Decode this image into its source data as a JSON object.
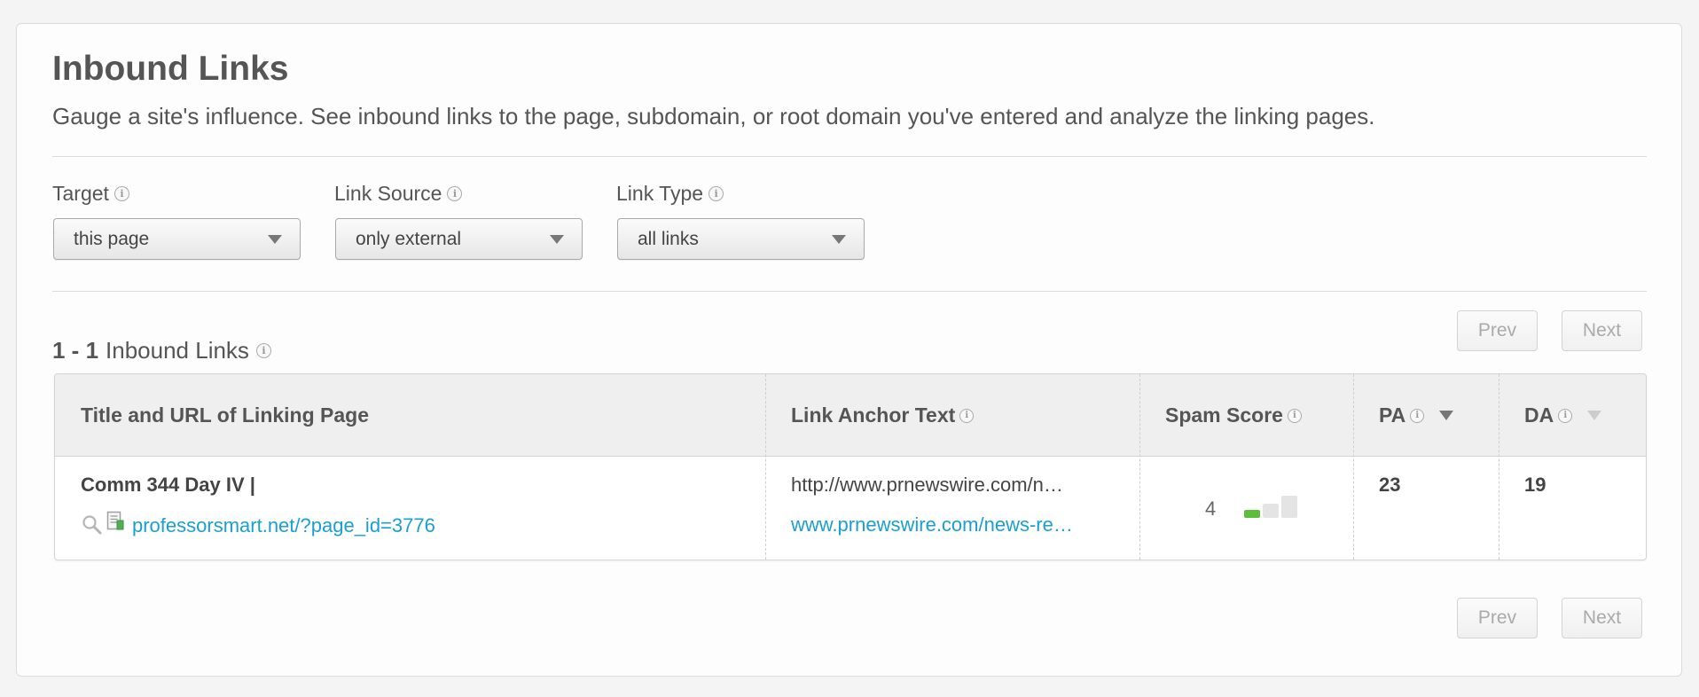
{
  "header": {
    "title": "Inbound Links",
    "subtitle": "Gauge a site's influence. See inbound links to the page, subdomain, or root domain you've entered and analyze the linking pages."
  },
  "filters": {
    "target": {
      "label": "Target",
      "value": "this page"
    },
    "link_source": {
      "label": "Link Source",
      "value": "only external"
    },
    "link_type": {
      "label": "Link Type",
      "value": "all links"
    }
  },
  "results": {
    "range": "1 - 1",
    "label": "Inbound Links"
  },
  "pager": {
    "prev_label": "Prev",
    "next_label": "Next"
  },
  "table": {
    "columns": {
      "title_url": "Title and URL of Linking Page",
      "anchor": "Link Anchor Text",
      "spam": "Spam Score",
      "pa": "PA",
      "da": "DA"
    },
    "rows": [
      {
        "title": "Comm 344 Day IV |",
        "url": "professorsmart.net/?page_id=3776",
        "anchor_text": "http://www.prnewswire.com/n…",
        "target_url": "www.prnewswire.com/news-re…",
        "spam_score": "4",
        "pa": "23",
        "da": "19"
      }
    ]
  },
  "colors": {
    "accent_link": "#1a9fd4",
    "spam_good": "#5bbf3a"
  },
  "icons": [
    "info-icon",
    "magnifier-icon",
    "page-icon",
    "sort-desc-icon"
  ]
}
